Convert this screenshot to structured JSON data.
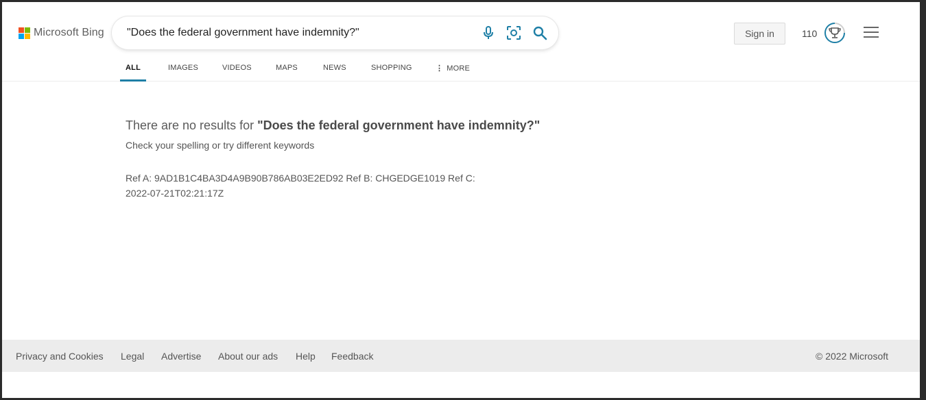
{
  "brand": {
    "name": "Microsoft Bing",
    "logo_colors": [
      "#f25022",
      "#7fba00",
      "#00a4ef",
      "#ffb900"
    ]
  },
  "search": {
    "query": "\"Does the federal government have indemnity?\"",
    "icons": [
      "microphone-icon",
      "visual-search-icon",
      "search-icon"
    ],
    "accent": "#1e7fa6"
  },
  "header": {
    "sign_in": "Sign in",
    "rewards_points": "110",
    "rewards_icon": "trophy-icon",
    "menu_icon": "hamburger-menu-icon"
  },
  "tabs": [
    {
      "label": "ALL",
      "active": true
    },
    {
      "label": "IMAGES",
      "active": false
    },
    {
      "label": "VIDEOS",
      "active": false
    },
    {
      "label": "MAPS",
      "active": false
    },
    {
      "label": "NEWS",
      "active": false
    },
    {
      "label": "SHOPPING",
      "active": false
    },
    {
      "label": "MORE",
      "active": false,
      "icon": "vertical-ellipsis-icon"
    }
  ],
  "results": {
    "no_results_prefix": "There are no results for ",
    "no_results_query": "\"Does the federal government have indemnity?\"",
    "hint": "Check your spelling or try different keywords",
    "ref_line1": "Ref A: 9AD1B1C4BA3D4A9B90B786AB03E2ED92 Ref B: CHGEDGE1019 Ref C:",
    "ref_line2": "2022-07-21T02:21:17Z"
  },
  "footer": {
    "links": [
      "Privacy and Cookies",
      "Legal",
      "Advertise",
      "About our ads",
      "Help",
      "Feedback"
    ],
    "copyright": "© 2022 Microsoft"
  }
}
